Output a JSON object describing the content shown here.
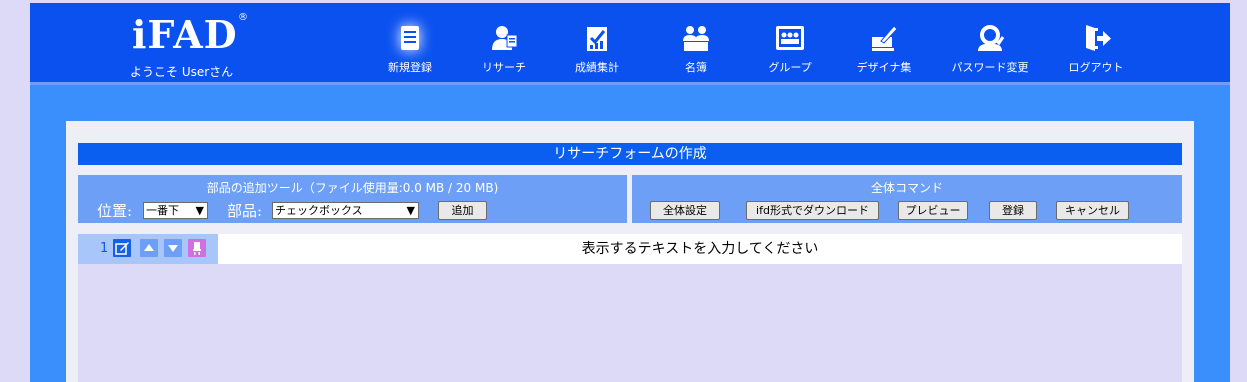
{
  "header": {
    "logo": "iFAD",
    "logo_reg": "®",
    "welcome": "ようこそ Userさん",
    "nav": [
      {
        "label": "新規登録",
        "icon": "new-document-icon",
        "active": true
      },
      {
        "label": "リサーチ",
        "icon": "research-icon"
      },
      {
        "label": "成績集計",
        "icon": "grade-summary-icon"
      },
      {
        "label": "名簿",
        "icon": "roster-icon"
      },
      {
        "label": "グループ",
        "icon": "group-icon"
      },
      {
        "label": "デザイナ集",
        "icon": "designer-icon"
      },
      {
        "label": "パスワード変更",
        "icon": "password-change-icon"
      },
      {
        "label": "ログアウト",
        "icon": "logout-icon"
      }
    ]
  },
  "form": {
    "title": "リサーチフォームの作成"
  },
  "tools": {
    "title": "部品の追加ツール（ファイル使用量:0.0 MB / 20 MB)",
    "position_label": "位置:",
    "position_value": "一番下",
    "part_label": "部品:",
    "part_value": "チェックボックス",
    "add_button": "追加"
  },
  "commands": {
    "title": "全体コマンド",
    "buttons": [
      "全体設定",
      "ifd形式でダウンロード",
      "プレビュー",
      "登録",
      "キャンセル"
    ]
  },
  "rows": [
    {
      "number": "1",
      "text": "表示するテキストを入力してください"
    }
  ],
  "colors": {
    "header_bg": "#0b51f0",
    "main_bg": "#3a8ffd",
    "title_bar": "#0b5ff0",
    "tool_box": "#6d9ff6",
    "row_ctrl": "#a9c6fb",
    "page_bg": "#dcdaf6"
  }
}
